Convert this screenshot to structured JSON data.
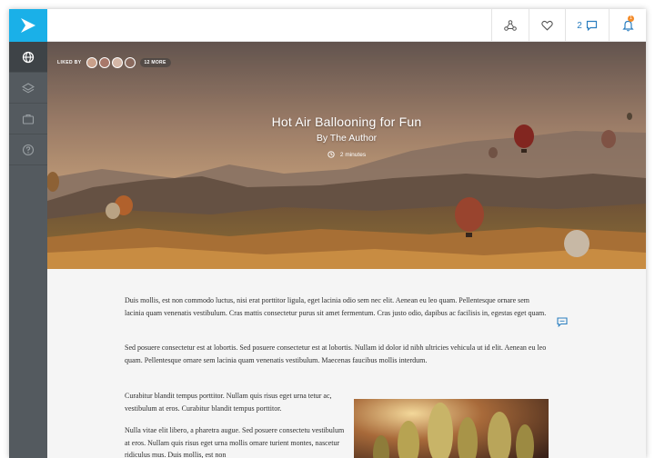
{
  "app": {
    "logo_icon": "arrow-logo-icon",
    "accent": "#1ab0e8"
  },
  "sidebar": {
    "items": [
      {
        "icon": "globe-icon",
        "active": true
      },
      {
        "icon": "layers-icon",
        "active": false
      },
      {
        "icon": "briefcase-icon",
        "active": false
      },
      {
        "icon": "help-circle-icon",
        "active": false
      }
    ]
  },
  "topbar": {
    "share_icon": "share-nodes-icon",
    "like_icon": "heart-icon",
    "comment_count": "2",
    "comment_icon": "comment-icon",
    "notification_icon": "bell-icon",
    "notification_badge": "1"
  },
  "hero": {
    "liked_by_label": "LIKED BY",
    "more_label": "12 MORE",
    "title": "Hot Air Ballooning for Fun",
    "author": "By The Author",
    "read_time": "2 minutes"
  },
  "article": {
    "paragraphs": [
      "Duis mollis, est non commodo luctus, nisi erat porttitor ligula, eget lacinia odio sem nec elit. Aenean eu leo quam. Pellentesque ornare sem lacinia quam venenatis vestibulum. Cras mattis consectetur purus sit amet fermentum. Cras justo odio, dapibus ac facilisis in, egestas eget quam.",
      "Sed posuere consectetur est at lobortis. Sed posuere consectetur est at lobortis. Nullam id dolor id nibh ultricies vehicula ut id elit. Aenean eu leo quam. Pellentesque ornare sem lacinia quam venenatis vestibulum. Maecenas faucibus mollis interdum.",
      "Curabitur blandit tempus porttitor. Nullam quis risus eget urna tetur ac, vestibulum at eros. Curabitur blandit tempus porttitor.",
      "Nulla vitae elit libero, a pharetra augue. Sed posuere consectetu vestibulum at eros. Nullam quis risus eget urna mollis ornare turient montes, nascetur ridiculus mus. Duis mollis, est non"
    ]
  }
}
